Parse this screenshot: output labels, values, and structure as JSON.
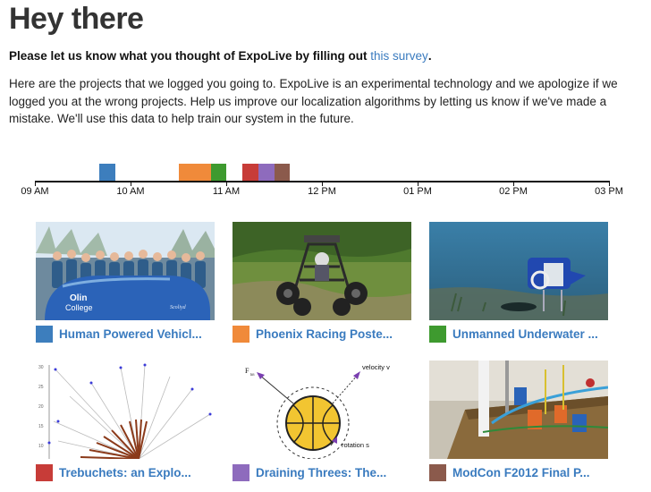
{
  "header": {
    "title": "Hey there"
  },
  "survey": {
    "prefix": "Please let us know what you thought of ExpoLive by filling out ",
    "link_text": "this survey",
    "suffix": "."
  },
  "intro": "Here are the projects that we logged you going to. ExpoLive is an experimental technology and we apologize if we logged you at the wrong projects. Help us improve our localization algorithms by letting us know if we've made a mistake. We'll use this data to help train our system in the future.",
  "timeline": {
    "ticks": [
      "09 AM",
      "10 AM",
      "11 AM",
      "12 PM",
      "01 PM",
      "02 PM",
      "03 PM"
    ],
    "colors": {
      "blue": "#3d7ebd",
      "orange": "#f08a3a",
      "green": "#3e9a2f",
      "red": "#c73c38",
      "purple": "#8e6bbd",
      "brown": "#8b5a4c"
    }
  },
  "projects": [
    {
      "title": "Human Powered Vehicl...",
      "color": "#3d7ebd",
      "thumbnail_text": [
        "Olin",
        "College",
        "Scoliyd"
      ]
    },
    {
      "title": "Phoenix Racing Poste...",
      "color": "#f08a3a"
    },
    {
      "title": "Unmanned Underwater ...",
      "color": "#3e9a2f"
    },
    {
      "title": "Trebuchets: an Explo...",
      "color": "#c73c38",
      "thumbnail_axis_ticks": [
        "30",
        "25",
        "20",
        "15",
        "10"
      ]
    },
    {
      "title": "Draining Threes: The...",
      "color": "#8e6bbd",
      "thumbnail_text": [
        "F",
        "lift",
        "velocity v",
        "rotation s"
      ]
    },
    {
      "title": "ModCon F2012 Final P...",
      "color": "#8b5a4c"
    }
  ]
}
